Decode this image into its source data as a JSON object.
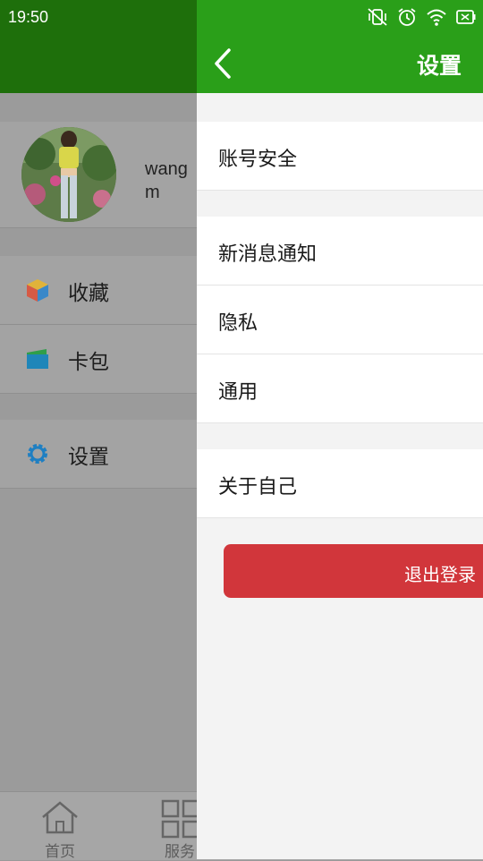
{
  "status_bar": {
    "time": "19:50",
    "icons": [
      "vibrate-off-icon",
      "alarm-icon",
      "wifi-icon",
      "battery-icon"
    ]
  },
  "drawer": {
    "profile": {
      "username": "wangm"
    },
    "menu": [
      {
        "label": "收藏",
        "icon": "cube-icon"
      },
      {
        "label": "卡包",
        "icon": "wallet-icon"
      },
      {
        "label": "设置",
        "icon": "gear-icon"
      }
    ],
    "bottom_tabs": [
      {
        "label": "首页",
        "icon": "home-icon"
      },
      {
        "label": "服务",
        "icon": "grid-icon"
      }
    ]
  },
  "settings": {
    "title": "设置",
    "items": [
      "账号安全",
      "新消息通知",
      "隐私",
      "通用",
      "关于自己"
    ],
    "logout_label": "退出登录"
  },
  "colors": {
    "header_green": "#2a9f19",
    "logout_red": "#d1363b",
    "dim_gray": "#9b9b9b"
  }
}
